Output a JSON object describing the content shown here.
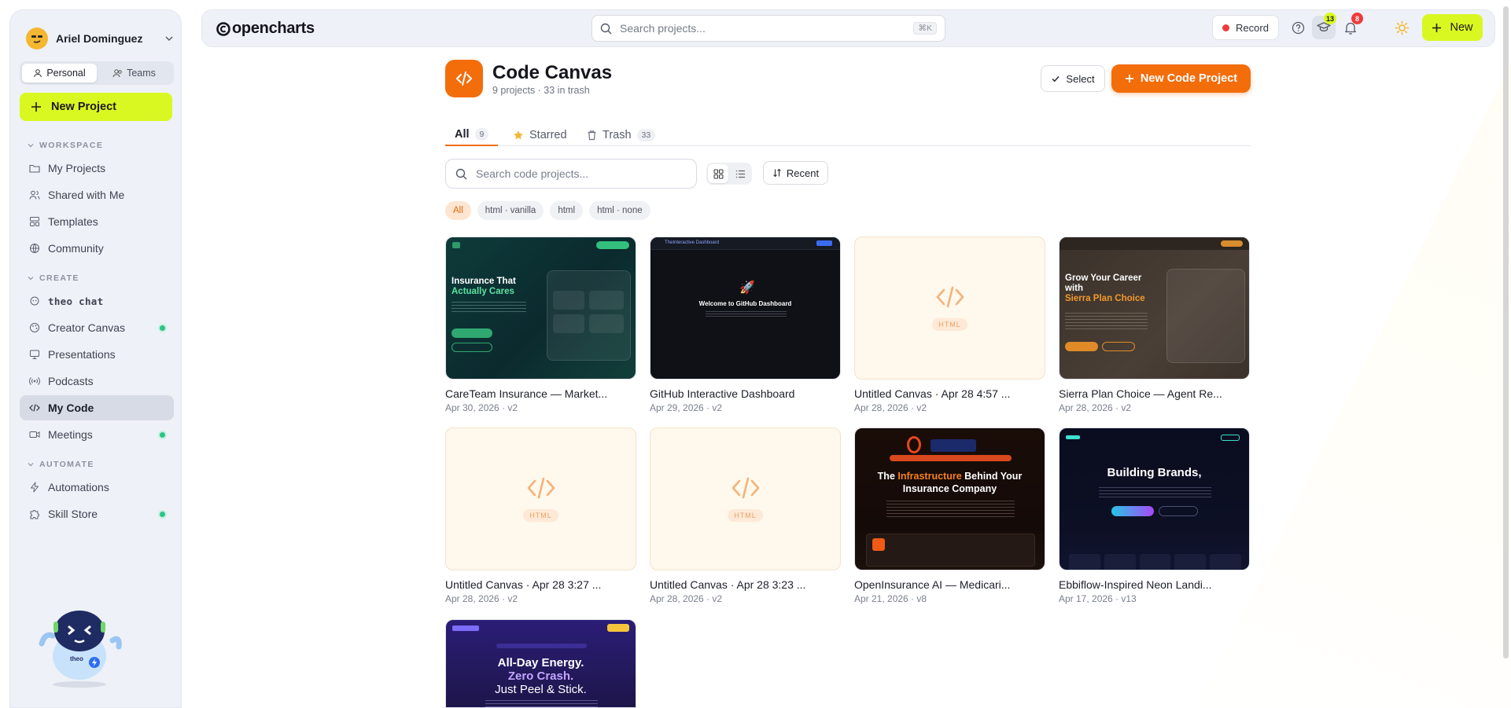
{
  "sidebar": {
    "user_name": "Ariel Dominguez",
    "scope_tabs": [
      "Personal",
      "Teams"
    ],
    "new_project_label": "New Project",
    "workspace_heading": "WORKSPACE",
    "workspace_items": [
      "My Projects",
      "Shared with Me",
      "Templates",
      "Community"
    ],
    "create_heading": "CREATE",
    "create_items": [
      "theo chat",
      "Creator Canvas",
      "Presentations",
      "Podcasts",
      "My Code",
      "Meetings"
    ],
    "automate_heading": "AUTOMATE",
    "automate_items": [
      "Automations",
      "Skill Store"
    ],
    "mascot_label": "theo"
  },
  "topbar": {
    "logo": "opencharts",
    "search_placeholder": "Search projects...",
    "search_shortcut": "⌘K",
    "record_label": "Record",
    "learn_badge": "13",
    "notif_badge": "8",
    "new_label": "New"
  },
  "page": {
    "title": "Code Canvas",
    "subtitle": "9 projects · 33 in trash",
    "select_label": "Select",
    "new_code_label": "New Code Project",
    "tabs": [
      {
        "label": "All",
        "count": "9"
      },
      {
        "label": "Starred",
        "count": ""
      },
      {
        "label": "Trash",
        "count": "33"
      }
    ],
    "search_placeholder": "Search code projects...",
    "sort_label": "Recent",
    "filters": [
      "All",
      "html · vanilla",
      "html",
      "html · none"
    ]
  },
  "cards": [
    {
      "title": "CareTeam Insurance — Market...",
      "meta": "Apr 30, 2026 · v2",
      "thumb_heading": "Insurance That",
      "thumb_accent": "Actually Cares"
    },
    {
      "title": "GitHub Interactive Dashboard",
      "meta": "Apr 29, 2026 · v2",
      "thumb_heading": "Welcome to GitHub Dashboard",
      "thumb_accent": "TheInteractive Dashboard"
    },
    {
      "title": "Untitled Canvas · Apr 28 4:57 ...",
      "meta": "Apr 28, 2026 · v2",
      "tag": "HTML"
    },
    {
      "title": "Sierra Plan Choice — Agent Re...",
      "meta": "Apr 28, 2026 · v2",
      "thumb_heading": "Grow Your Career with",
      "thumb_accent": "Sierra Plan Choice"
    },
    {
      "title": "Untitled Canvas · Apr 28 3:27 ...",
      "meta": "Apr 28, 2026 · v2",
      "tag": "HTML"
    },
    {
      "title": "Untitled Canvas · Apr 28 3:23 ...",
      "meta": "Apr 28, 2026 · v2",
      "tag": "HTML"
    },
    {
      "title": "OpenInsurance AI — Medicari...",
      "meta": "Apr 21, 2026 · v8",
      "thumb_heading": "The",
      "thumb_accent": "Infrastructure",
      "thumb_rest": "Behind Your Insurance Company"
    },
    {
      "title": "Ebbiflow-Inspired Neon Landi...",
      "meta": "Apr 17, 2026 · v13",
      "thumb_heading": "Building Brands,"
    },
    {
      "title": "",
      "meta": "",
      "thumb_heading": "All-Day Energy.",
      "thumb_accent": "Zero Crash.",
      "thumb_rest": "Just Peel & Stick."
    }
  ]
}
